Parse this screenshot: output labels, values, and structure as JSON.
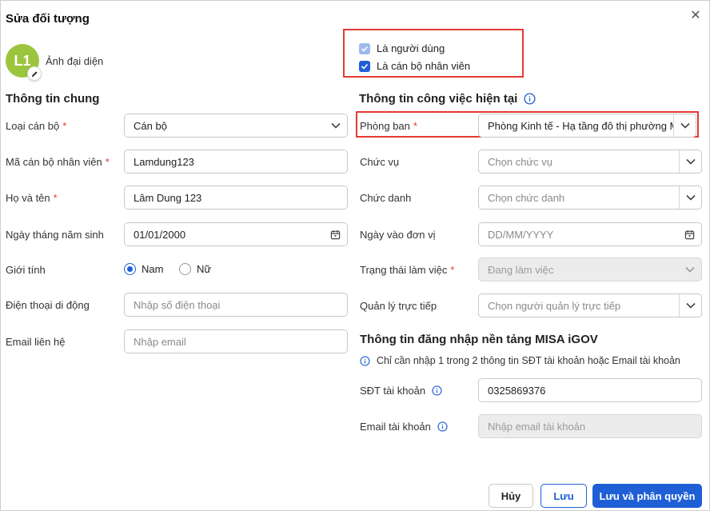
{
  "dialog": {
    "title": "Sửa đối tượng"
  },
  "avatar": {
    "initials": "L1",
    "label": "Ảnh đại diện"
  },
  "checks": {
    "is_user": {
      "label": "Là người dùng",
      "checked": true,
      "disabled": true
    },
    "is_staff": {
      "label": "Là cán bộ nhân viên",
      "checked": true
    }
  },
  "general": {
    "title": "Thông tin chung",
    "staff_type": {
      "label": "Loại cán bộ",
      "value": "Cán bộ"
    },
    "staff_code": {
      "label": "Mã cán bộ nhân viên",
      "value": "Lamdung123"
    },
    "full_name": {
      "label": "Họ và tên",
      "value": "Lâm Dung 123"
    },
    "birthday": {
      "label": "Ngày tháng năm sinh",
      "value": "01/01/2000"
    },
    "gender": {
      "label": "Giới tính",
      "options": [
        "Nam",
        "Nữ"
      ],
      "selected": "Nam"
    },
    "phone": {
      "label": "Điện thoại di động",
      "placeholder": "Nhập số điện thoại"
    },
    "email": {
      "label": "Email liên hệ",
      "placeholder": "Nhập email"
    }
  },
  "job": {
    "title": "Thông tin công việc hiện tại",
    "department": {
      "label": "Phòng ban",
      "value": "Phòng Kinh tế - Hạ tầng đô thị phường MI"
    },
    "position": {
      "label": "Chức vụ",
      "placeholder": "Chọn chức vụ"
    },
    "job_title": {
      "label": "Chức danh",
      "placeholder": "Chọn chức danh"
    },
    "join_date": {
      "label": "Ngày vào đơn vị",
      "placeholder": "DD/MM/YYYY"
    },
    "work_status": {
      "label": "Trạng thái làm việc",
      "value": "Đang làm việc"
    },
    "manager": {
      "label": "Quản lý trực tiếp",
      "placeholder": "Chọn người quản lý trực tiếp"
    }
  },
  "login": {
    "title": "Thông tin đăng nhập nền tảng MISA iGOV",
    "note": "Chỉ cần nhập 1 trong 2 thông tin SĐT tài khoản hoặc Email tài khoản",
    "phone": {
      "label": "SĐT tài khoản",
      "value": "0325869376"
    },
    "email": {
      "label": "Email tài khoản",
      "placeholder": "Nhập email tài khoản"
    }
  },
  "actions": {
    "cancel": "Hủy",
    "save": "Lưu",
    "save_and_assign": "Lưu và phân quyền"
  },
  "colors": {
    "primary": "#1f5fd6",
    "highlight": "#e53935",
    "avatar": "#9bc53d"
  }
}
